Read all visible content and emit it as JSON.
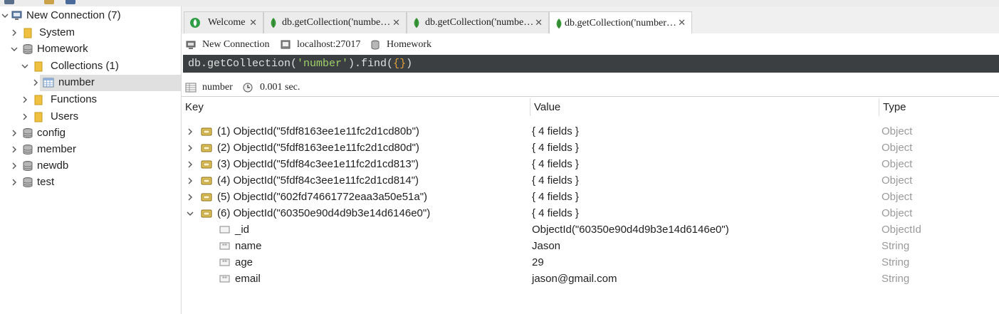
{
  "sidebar": {
    "items": [
      {
        "label": "New Connection (7)",
        "icon": "server-icon",
        "expanded": true
      },
      {
        "label": "System",
        "icon": "folder-icon",
        "expanded": false
      },
      {
        "label": "Homework",
        "icon": "database-icon",
        "expanded": true
      },
      {
        "label": "Collections (1)",
        "icon": "folder-icon",
        "expanded": true
      },
      {
        "label": "number",
        "icon": "table-icon",
        "expanded": false,
        "selected": true
      },
      {
        "label": "Functions",
        "icon": "folder-icon",
        "expanded": false
      },
      {
        "label": "Users",
        "icon": "folder-icon",
        "expanded": false
      },
      {
        "label": "config",
        "icon": "database-icon",
        "expanded": false
      },
      {
        "label": "member",
        "icon": "database-icon",
        "expanded": false
      },
      {
        "label": "newdb",
        "icon": "database-icon",
        "expanded": false
      },
      {
        "label": "test",
        "icon": "database-icon",
        "expanded": false
      }
    ]
  },
  "tabs": [
    {
      "label": "Welcome",
      "active": false
    },
    {
      "label": "db.getCollection('numbe…",
      "active": false
    },
    {
      "label": "db.getCollection('numbe…",
      "active": false
    },
    {
      "label": "db.getCollection('number…",
      "active": true
    }
  ],
  "info": {
    "connection": "New Connection",
    "host": "localhost:27017",
    "database": "Homework"
  },
  "query": {
    "prefix": "db.getCollection(",
    "string": "'number'",
    "mid": ").find(",
    "brace": "{}",
    "suffix": ")"
  },
  "status": {
    "collection": "number",
    "time": "0.001 sec."
  },
  "columns": {
    "key": "Key",
    "value": "Value",
    "type": "Type"
  },
  "rows": [
    {
      "key": "(1) ObjectId(\"5fdf8163ee1e11fc2d1cd80b\")",
      "value": "{ 4 fields }",
      "type": "Object"
    },
    {
      "key": "(2) ObjectId(\"5fdf8163ee1e11fc2d1cd80d\")",
      "value": "{ 4 fields }",
      "type": "Object"
    },
    {
      "key": "(3) ObjectId(\"5fdf84c3ee1e11fc2d1cd813\")",
      "value": "{ 4 fields }",
      "type": "Object"
    },
    {
      "key": "(4) ObjectId(\"5fdf84c3ee1e11fc2d1cd814\")",
      "value": "{ 4 fields }",
      "type": "Object"
    },
    {
      "key": "(5) ObjectId(\"602fd74661772eaa3a50e51a\")",
      "value": "{ 4 fields }",
      "type": "Object"
    },
    {
      "key": "(6) ObjectId(\"60350e90d4d9b3e14d6146e0\")",
      "value": "{ 4 fields }",
      "type": "Object"
    }
  ],
  "fields": [
    {
      "key": "_id",
      "value": "ObjectId(\"60350e90d4d9b3e14d6146e0\")",
      "type": "ObjectId"
    },
    {
      "key": "name",
      "value": "Jason",
      "type": "String"
    },
    {
      "key": "age",
      "value": "29",
      "type": "String"
    },
    {
      "key": "email",
      "value": "jason@gmail.com",
      "type": "String"
    }
  ]
}
